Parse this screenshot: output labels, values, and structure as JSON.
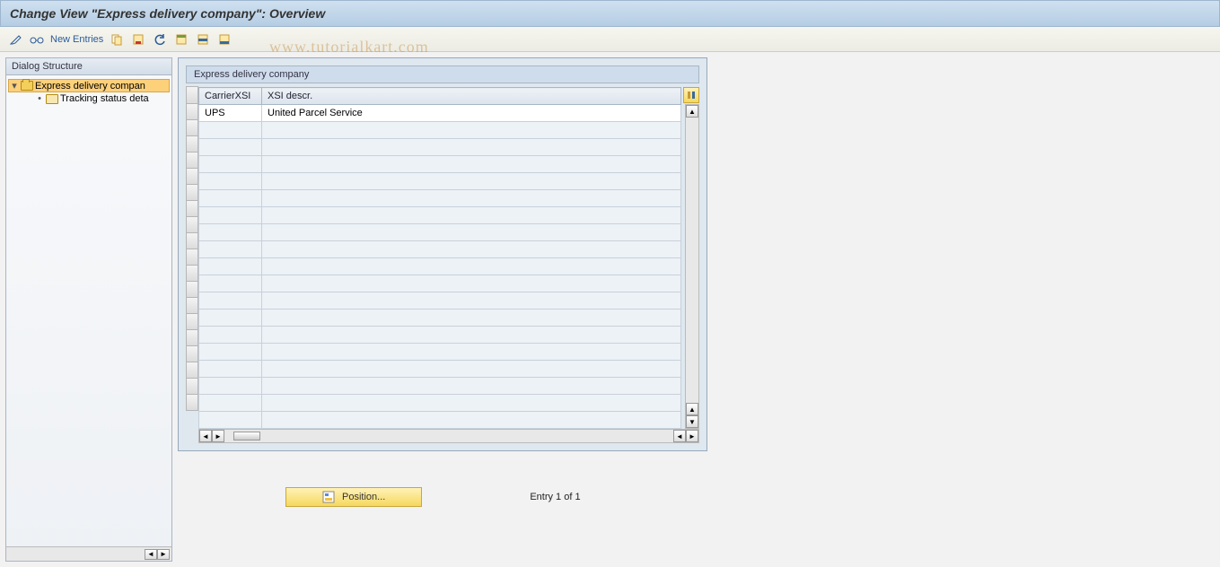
{
  "title": "Change View \"Express delivery company\": Overview",
  "toolbar": {
    "new_entries": "New Entries"
  },
  "watermark": "www.tutorialkart.com",
  "sidebar": {
    "header": "Dialog Structure",
    "node1": "Express delivery compan",
    "node2": "Tracking status deta"
  },
  "grid": {
    "panel_title": "Express delivery company",
    "col1": "CarrierXSI",
    "col2": "XSI descr.",
    "rows": [
      {
        "carrier": "UPS",
        "desc": "United Parcel Service"
      }
    ],
    "empty_rows": 18
  },
  "footer": {
    "position_label": "Position...",
    "entry_text": "Entry 1 of 1"
  }
}
